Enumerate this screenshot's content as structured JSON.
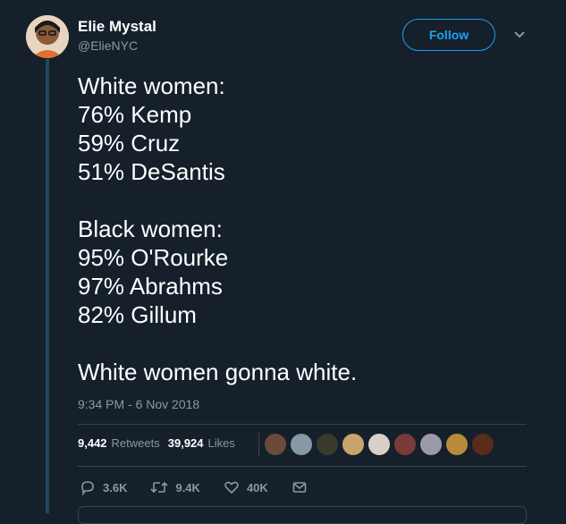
{
  "author": {
    "name": "Elie Mystal",
    "handle": "@ElieNYC"
  },
  "follow_label": "Follow",
  "tweet": {
    "lines_group1": [
      "White women:",
      "76% Kemp",
      "59% Cruz",
      "51% DeSantis"
    ],
    "lines_group2": [
      "Black women:",
      "95% O'Rourke",
      "97% Abrahms",
      "82% Gillum"
    ],
    "closing": "White women gonna white."
  },
  "timestamp": "9:34 PM - 6 Nov 2018",
  "stats": {
    "retweets_count": "9,442",
    "retweets_label": "Retweets",
    "likes_count": "39,924",
    "likes_label": "Likes"
  },
  "likers": [
    {
      "icon": "liker-avatar",
      "color": "#6b4a3a"
    },
    {
      "icon": "default-avatar",
      "color": "#8899a6"
    },
    {
      "icon": "liker-avatar",
      "color": "#3a3a2a"
    },
    {
      "icon": "liker-avatar",
      "color": "#c9a46a"
    },
    {
      "icon": "liker-avatar",
      "color": "#d8d0c8"
    },
    {
      "icon": "liker-avatar",
      "color": "#7a3a3a"
    },
    {
      "icon": "liker-avatar",
      "color": "#9a9aa8"
    },
    {
      "icon": "liker-avatar",
      "color": "#b88a3a"
    },
    {
      "icon": "liker-avatar",
      "color": "#5a2a1a"
    }
  ],
  "actions": {
    "replies": "3.6K",
    "retweets": "9.4K",
    "likes": "40K"
  },
  "colors": {
    "background": "#15202b",
    "accent": "#1da1f2",
    "muted": "#8899a6",
    "thread_line": "#22485e"
  }
}
